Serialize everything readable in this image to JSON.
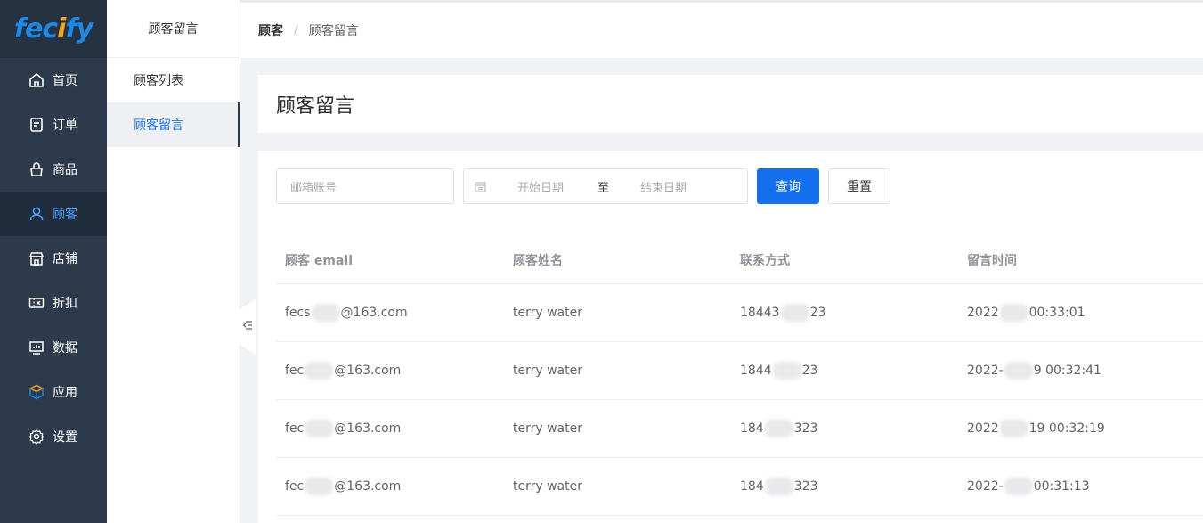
{
  "logo": {
    "text_a": "fec",
    "text_b": "i",
    "text_c": "fy"
  },
  "nav": {
    "items": [
      {
        "label": "首页",
        "icon": "home-icon"
      },
      {
        "label": "订单",
        "icon": "order-icon"
      },
      {
        "label": "商品",
        "icon": "bag-icon"
      },
      {
        "label": "顾客",
        "icon": "user-icon",
        "active": true
      },
      {
        "label": "店铺",
        "icon": "store-icon"
      },
      {
        "label": "折扣",
        "icon": "coupon-icon"
      },
      {
        "label": "数据",
        "icon": "chart-icon"
      },
      {
        "label": "应用",
        "icon": "cube-icon"
      },
      {
        "label": "设置",
        "icon": "gear-icon"
      }
    ]
  },
  "subnav": {
    "title": "顾客留言",
    "items": [
      {
        "label": "顾客列表"
      },
      {
        "label": "顾客留言",
        "active": true
      }
    ]
  },
  "breadcrumb": {
    "parent": "顾客",
    "separator": "/",
    "current": "顾客留言"
  },
  "page": {
    "title": "顾客留言"
  },
  "filters": {
    "email_placeholder": "邮箱账号",
    "start_placeholder": "开始日期",
    "range_separator": "至",
    "end_placeholder": "结束日期",
    "search_label": "查询",
    "reset_label": "重置"
  },
  "table": {
    "headers": [
      "顾客 email",
      "顾客姓名",
      "联系方式",
      "留言时间"
    ],
    "rows": [
      {
        "email_a": "fecs",
        "email_b": "@163.com",
        "name": "terry water",
        "phone_a": "18443",
        "phone_b": "23",
        "time_a": "2022",
        "time_b": "00:33:01"
      },
      {
        "email_a": "fec",
        "email_b": "@163.com",
        "name": "terry water",
        "phone_a": "1844",
        "phone_b": "23",
        "time_a": "2022-",
        "time_b": "9 00:32:41"
      },
      {
        "email_a": "fec",
        "email_b": "@163.com",
        "name": "terry water",
        "phone_a": "184",
        "phone_b": "323",
        "time_a": "2022",
        "time_b": "19 00:32:19"
      },
      {
        "email_a": "fec",
        "email_b": "@163.com",
        "name": "terry water",
        "phone_a": "184",
        "phone_b": "323",
        "time_a": "2022-",
        "time_b": "00:31:13"
      }
    ]
  },
  "colors": {
    "nav_bg": "#2d3a4b",
    "accent": "#1570ef",
    "active_text": "#4f9dff"
  }
}
